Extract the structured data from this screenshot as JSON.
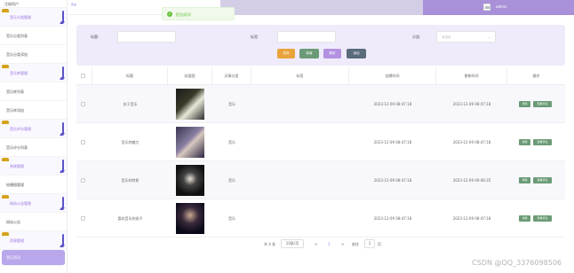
{
  "sidebar": {
    "items": [
      {
        "label": "注册用户",
        "type": "item"
      },
      {
        "label": "音乐分类管理",
        "type": "header"
      },
      {
        "label": "音乐分类列表",
        "type": "item"
      },
      {
        "label": "音乐分类添加",
        "type": "item"
      },
      {
        "label": "音乐库管理",
        "type": "header"
      },
      {
        "label": "音乐库列表",
        "type": "item"
      },
      {
        "label": "音乐库添加",
        "type": "item"
      },
      {
        "label": "音乐评分管理",
        "type": "header"
      },
      {
        "label": "音乐评分列表",
        "type": "item"
      },
      {
        "label": "系统管理",
        "type": "header"
      },
      {
        "label": "轮播图管理",
        "type": "item"
      },
      {
        "label": "网站公告管理",
        "type": "header"
      },
      {
        "label": "网站公告",
        "type": "item"
      },
      {
        "label": "资源管理",
        "type": "header"
      },
      {
        "label": "音乐资讯",
        "type": "active"
      },
      {
        "label": "资讯分类",
        "type": "item"
      }
    ]
  },
  "topbar": {
    "logo": "欢迎",
    "username": "admin"
  },
  "toast": {
    "icon": "check-icon",
    "message": "提交成功!"
  },
  "search": {
    "field1_label": "标题:",
    "field2_label": "标签:",
    "field3_label": "分类:",
    "select_placeholder": "请选择",
    "buttons": [
      "查询",
      "新增",
      "删除",
      "添加"
    ]
  },
  "colors": {
    "accent": "#9370db",
    "btn_search": "#e8a33a",
    "btn_add": "#6b9b76",
    "btn_delete": "#b391e0",
    "btn_extra": "#5a6b7b",
    "op_button": "#6b9b76"
  },
  "table": {
    "headers": [
      "标题",
      "封面图",
      "文章分类",
      "标签",
      "创建时间",
      "更新时间",
      "操作"
    ],
    "rows": [
      {
        "title": "关于音乐",
        "category": "音乐",
        "tags": "",
        "created": "2023-12-09 08:47:18",
        "updated": "2023-12-09 08:47:18",
        "ops": [
          "详情",
          "查看评论"
        ]
      },
      {
        "title": "音乐的魅力",
        "category": "音乐",
        "tags": "",
        "created": "2023-12-09 08:47:18",
        "updated": "2023-12-09 08:47:18",
        "ops": [
          "详情",
          "查看评论"
        ]
      },
      {
        "title": "音乐的特质",
        "category": "音乐",
        "tags": "",
        "created": "2023-12-09 08:47:18",
        "updated": "2023-12-09 09:46:35",
        "ops": [
          "详情",
          "查看评论"
        ]
      },
      {
        "title": "喜欢音乐的孩子",
        "category": "音乐",
        "tags": "",
        "created": "2023-12-09 08:47:18",
        "updated": "2023-12-09 08:47:18",
        "ops": [
          "详情",
          "查看评论"
        ]
      }
    ]
  },
  "pagination": {
    "total": "共 4 条",
    "page_size": "10条/页",
    "prev": "<",
    "current": "1",
    "next": ">",
    "goto_label": "前往",
    "goto_value": "1",
    "goto_suffix": "页"
  },
  "watermark": "CSDN @QQ_3376098506"
}
